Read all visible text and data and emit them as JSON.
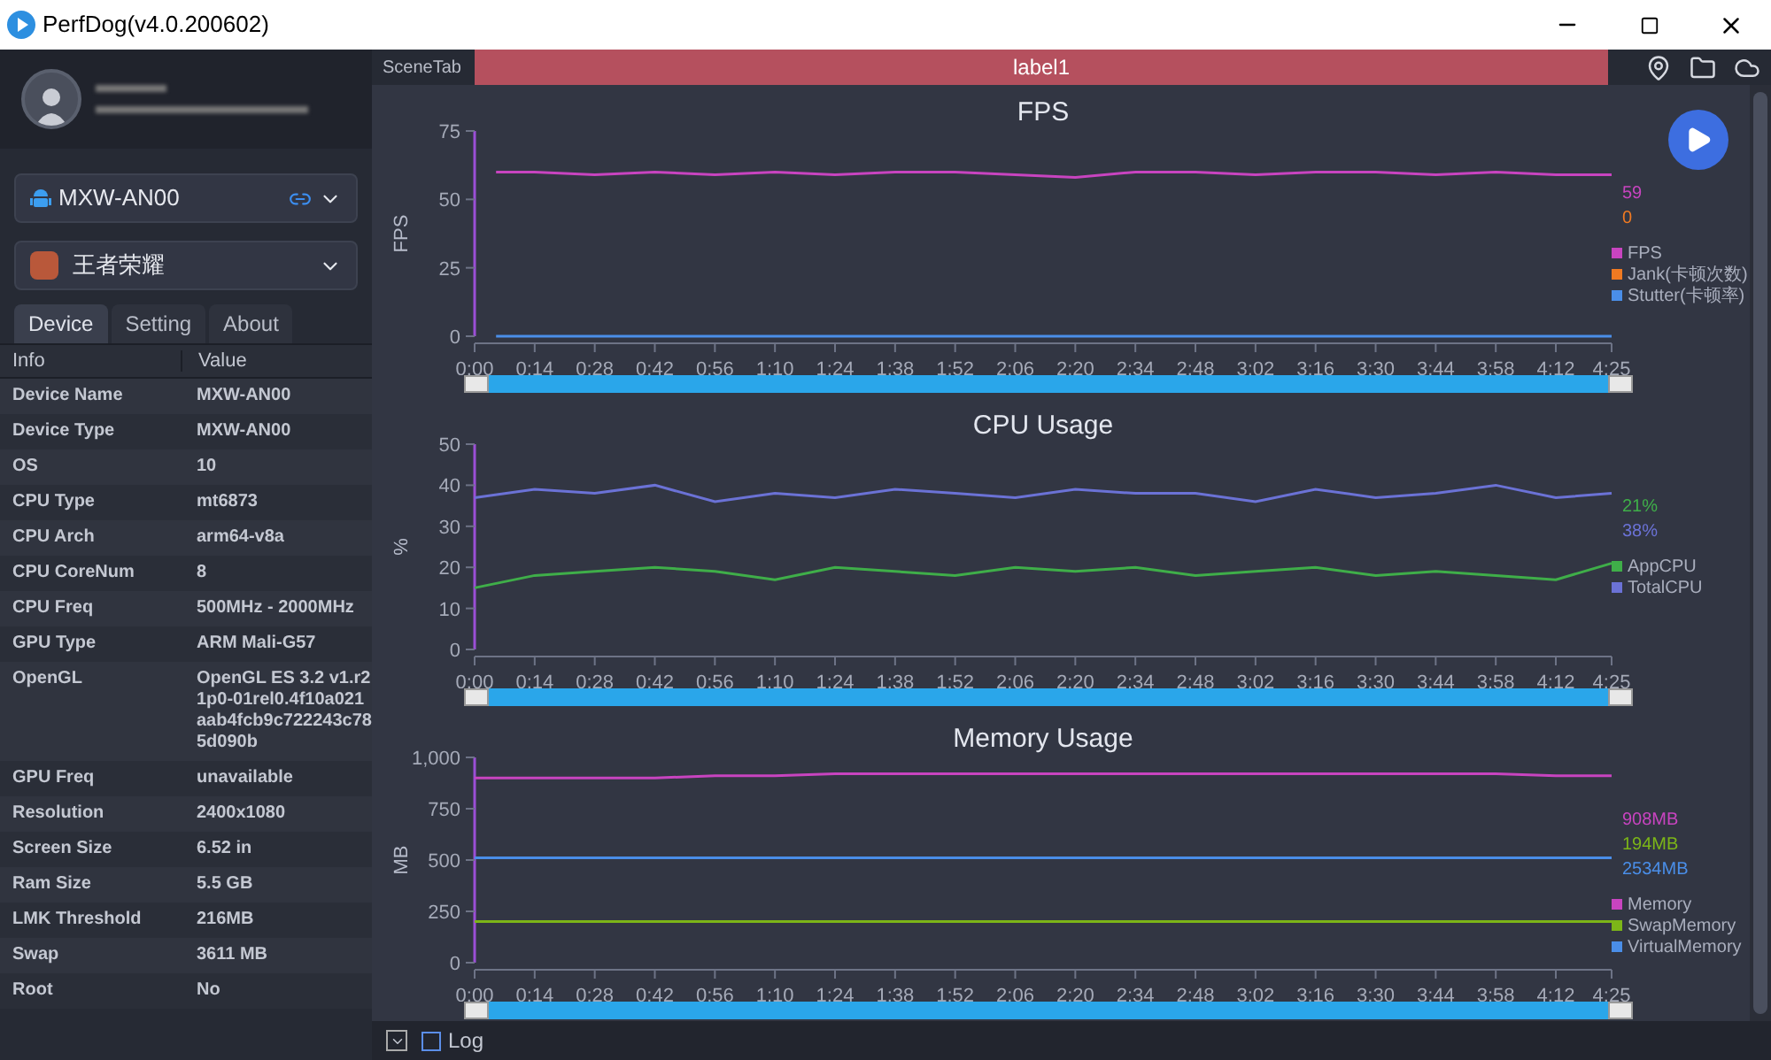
{
  "window": {
    "title": "PerfDog(v4.0.200602)"
  },
  "sidebar": {
    "device_select": {
      "value": "MXW-AN00"
    },
    "app_select": {
      "value": "王者荣耀"
    },
    "tabs": [
      {
        "label": "Device",
        "selected": true
      },
      {
        "label": "Setting",
        "selected": false
      },
      {
        "label": "About",
        "selected": false
      }
    ],
    "table": {
      "columns": [
        "Info",
        "Value"
      ],
      "rows": [
        {
          "info": "Device Name",
          "value": "MXW-AN00"
        },
        {
          "info": "Device Type",
          "value": "MXW-AN00"
        },
        {
          "info": "OS",
          "value": "10"
        },
        {
          "info": "CPU Type",
          "value": "mt6873"
        },
        {
          "info": "CPU Arch",
          "value": "arm64-v8a"
        },
        {
          "info": "CPU CoreNum",
          "value": "8"
        },
        {
          "info": "CPU Freq",
          "value": "500MHz - 2000MHz"
        },
        {
          "info": "GPU Type",
          "value": "ARM Mali-G57"
        },
        {
          "info": "OpenGL",
          "value": "OpenGL ES 3.2 v1.r21p0-01rel0.4f10a021aab4fcb9c722243c785d090b"
        },
        {
          "info": "GPU Freq",
          "value": "unavailable"
        },
        {
          "info": "Resolution",
          "value": "2400x1080"
        },
        {
          "info": "Screen Size",
          "value": "6.52 in"
        },
        {
          "info": "Ram Size",
          "value": "5.5 GB"
        },
        {
          "info": "LMK Threshold",
          "value": "216MB"
        },
        {
          "info": "Swap",
          "value": "3611 MB"
        },
        {
          "info": "Root",
          "value": "No"
        }
      ]
    }
  },
  "scene_bar": {
    "label": "SceneTab",
    "scene": "label1"
  },
  "charts": [
    {
      "readings": [
        "59",
        "0"
      ],
      "slider": {
        "level": 1
      },
      "chart_data": {
        "type": "line",
        "title": "FPS",
        "ylabel": "FPS",
        "legend": true,
        "x": [
          5,
          14,
          28,
          42,
          56,
          70,
          84,
          98,
          112,
          126,
          140,
          154,
          168,
          182,
          196,
          210,
          224,
          238,
          252,
          265
        ],
        "xlim": [
          0,
          265
        ],
        "ylim": [
          0,
          75
        ],
        "yticks": [
          {
            "value": 0,
            "label": "0"
          },
          {
            "value": 25,
            "label": "25"
          },
          {
            "value": 50,
            "label": "50"
          },
          {
            "value": 75,
            "label": "75"
          }
        ],
        "xticks": [
          {
            "value": 0,
            "label": "0:00"
          },
          {
            "value": 14,
            "label": "0:14"
          },
          {
            "value": 28,
            "label": "0:28"
          },
          {
            "value": 42,
            "label": "0:42"
          },
          {
            "value": 56,
            "label": "0:56"
          },
          {
            "value": 70,
            "label": "1:10"
          },
          {
            "value": 84,
            "label": "1:24"
          },
          {
            "value": 98,
            "label": "1:38"
          },
          {
            "value": 112,
            "label": "1:52"
          },
          {
            "value": 126,
            "label": "2:06"
          },
          {
            "value": 140,
            "label": "2:20"
          },
          {
            "value": 154,
            "label": "2:34"
          },
          {
            "value": 168,
            "label": "2:48"
          },
          {
            "value": 182,
            "label": "3:02"
          },
          {
            "value": 196,
            "label": "3:16"
          },
          {
            "value": 210,
            "label": "3:30"
          },
          {
            "value": 224,
            "label": "3:44"
          },
          {
            "value": 238,
            "label": "3:58"
          },
          {
            "value": 252,
            "label": "4:12"
          },
          {
            "value": 265,
            "label": "4:25"
          }
        ],
        "series": [
          {
            "name": "FPS",
            "color": "#c844c0",
            "values": [
              60,
              60,
              59,
              60,
              59,
              60,
              59,
              60,
              60,
              59,
              58,
              60,
              60,
              59,
              60,
              60,
              59,
              60,
              59,
              59
            ]
          },
          {
            "name": "Jank(卡顿次数)",
            "color": "#f07a22",
            "values": [
              null,
              null,
              null,
              null,
              null,
              null,
              null,
              null,
              null,
              null,
              null,
              null,
              null,
              null,
              null,
              null,
              null,
              null,
              null,
              null
            ]
          },
          {
            "name": "Stutter(卡顿率)",
            "color": "#4a8ee8",
            "values": [
              0,
              0,
              0,
              0,
              0,
              0,
              0,
              0,
              0,
              0,
              0,
              0,
              0,
              0,
              0,
              0,
              0,
              0,
              0,
              0
            ]
          }
        ]
      }
    },
    {
      "readings": [
        "21%",
        "38%"
      ],
      "slider": {
        "level": 1
      },
      "chart_data": {
        "type": "line",
        "title": "CPU Usage",
        "ylabel": "%",
        "legend": true,
        "x": [
          0,
          14,
          28,
          42,
          56,
          70,
          84,
          98,
          112,
          126,
          140,
          154,
          168,
          182,
          196,
          210,
          224,
          238,
          252,
          265
        ],
        "xlim": [
          0,
          265
        ],
        "ylim": [
          0,
          50
        ],
        "yticks": [
          {
            "value": 0,
            "label": "0"
          },
          {
            "value": 10,
            "label": "10"
          },
          {
            "value": 20,
            "label": "20"
          },
          {
            "value": 30,
            "label": "30"
          },
          {
            "value": 40,
            "label": "40"
          },
          {
            "value": 50,
            "label": "50"
          }
        ],
        "xticks": [
          {
            "value": 0,
            "label": "0:00"
          },
          {
            "value": 14,
            "label": "0:14"
          },
          {
            "value": 28,
            "label": "0:28"
          },
          {
            "value": 42,
            "label": "0:42"
          },
          {
            "value": 56,
            "label": "0:56"
          },
          {
            "value": 70,
            "label": "1:10"
          },
          {
            "value": 84,
            "label": "1:24"
          },
          {
            "value": 98,
            "label": "1:38"
          },
          {
            "value": 112,
            "label": "1:52"
          },
          {
            "value": 126,
            "label": "2:06"
          },
          {
            "value": 140,
            "label": "2:20"
          },
          {
            "value": 154,
            "label": "2:34"
          },
          {
            "value": 168,
            "label": "2:48"
          },
          {
            "value": 182,
            "label": "3:02"
          },
          {
            "value": 196,
            "label": "3:16"
          },
          {
            "value": 210,
            "label": "3:30"
          },
          {
            "value": 224,
            "label": "3:44"
          },
          {
            "value": 238,
            "label": "3:58"
          },
          {
            "value": 252,
            "label": "4:12"
          },
          {
            "value": 265,
            "label": "4:25"
          }
        ],
        "series": [
          {
            "name": "AppCPU",
            "color": "#3fae49",
            "values": [
              15,
              18,
              19,
              20,
              19,
              17,
              20,
              19,
              18,
              20,
              19,
              20,
              18,
              19,
              20,
              18,
              19,
              18,
              17,
              21
            ]
          },
          {
            "name": "TotalCPU",
            "color": "#6b72d6",
            "values": [
              37,
              39,
              38,
              40,
              36,
              38,
              37,
              39,
              38,
              37,
              39,
              38,
              38,
              36,
              39,
              37,
              38,
              40,
              37,
              38
            ]
          }
        ]
      }
    },
    {
      "readings": [
        "908MB",
        "194MB",
        "2534MB"
      ],
      "slider": {
        "level": 1
      },
      "chart_data": {
        "type": "line",
        "title": "Memory Usage",
        "ylabel": "MB",
        "legend": true,
        "x": [
          0,
          14,
          28,
          42,
          56,
          70,
          84,
          98,
          112,
          126,
          140,
          154,
          168,
          182,
          196,
          210,
          224,
          238,
          252,
          265
        ],
        "xlim": [
          0,
          265
        ],
        "ylim": [
          0,
          1000
        ],
        "yticks": [
          {
            "value": 0,
            "label": "0"
          },
          {
            "value": 250,
            "label": "250"
          },
          {
            "value": 500,
            "label": "500"
          },
          {
            "value": 750,
            "label": "750"
          },
          {
            "value": 1000,
            "label": "1,000"
          }
        ],
        "xticks": [
          {
            "value": 0,
            "label": "0:00"
          },
          {
            "value": 14,
            "label": "0:14"
          },
          {
            "value": 28,
            "label": "0:28"
          },
          {
            "value": 42,
            "label": "0:42"
          },
          {
            "value": 56,
            "label": "0:56"
          },
          {
            "value": 70,
            "label": "1:10"
          },
          {
            "value": 84,
            "label": "1:24"
          },
          {
            "value": 98,
            "label": "1:38"
          },
          {
            "value": 112,
            "label": "1:52"
          },
          {
            "value": 126,
            "label": "2:06"
          },
          {
            "value": 140,
            "label": "2:20"
          },
          {
            "value": 154,
            "label": "2:34"
          },
          {
            "value": 168,
            "label": "2:48"
          },
          {
            "value": 182,
            "label": "3:02"
          },
          {
            "value": 196,
            "label": "3:16"
          },
          {
            "value": 210,
            "label": "3:30"
          },
          {
            "value": 224,
            "label": "3:44"
          },
          {
            "value": 238,
            "label": "3:58"
          },
          {
            "value": 252,
            "label": "4:12"
          },
          {
            "value": 265,
            "label": "4:25"
          }
        ],
        "series": [
          {
            "name": "Memory",
            "color": "#c844c0",
            "values": [
              900,
              900,
              900,
              900,
              910,
              910,
              920,
              920,
              920,
              920,
              920,
              920,
              920,
              920,
              920,
              920,
              920,
              920,
              910,
              910
            ]
          },
          {
            "name": "SwapMemory",
            "color": "#7cb518",
            "values": [
              200,
              200,
              200,
              200,
              200,
              200,
              200,
              200,
              200,
              200,
              200,
              200,
              200,
              200,
              200,
              200,
              200,
              200,
              200,
              200
            ]
          },
          {
            "name": "VirtualMemory",
            "color": "#4a8ee8",
            "values": [
              510,
              510,
              510,
              510,
              510,
              510,
              510,
              510,
              510,
              510,
              510,
              510,
              510,
              510,
              510,
              510,
              510,
              510,
              510,
              510
            ]
          }
        ]
      }
    }
  ],
  "bottom_bar": {
    "log": {
      "label": "Log",
      "checked": false
    }
  }
}
